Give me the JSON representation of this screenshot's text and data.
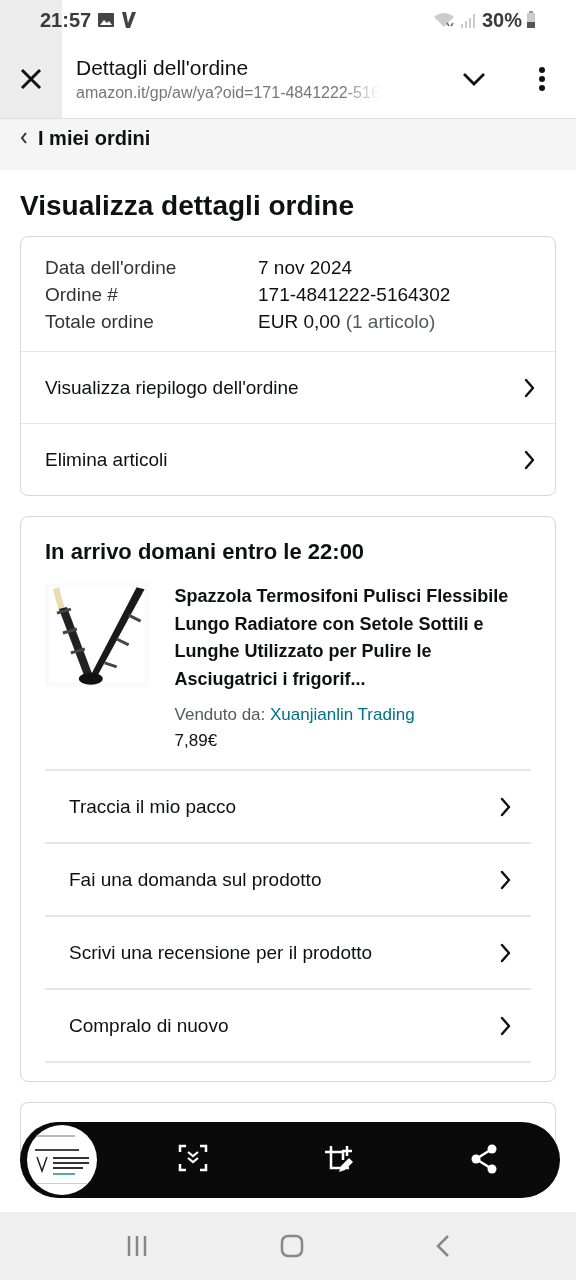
{
  "status_bar": {
    "time": "21:57",
    "battery": "30%"
  },
  "browser": {
    "title": "Dettagli dell'ordine",
    "url": "amazon.it/gp/aw/ya?oid=171-4841222-516"
  },
  "breadcrumb": "I miei ordini",
  "heading": "Visualizza dettagli ordine",
  "summary": {
    "fields": [
      {
        "label": "Data dell'ordine",
        "value": "7 nov 2024"
      },
      {
        "label": "Ordine #",
        "value": "171-4841222-5164302"
      },
      {
        "label": "Totale ordine",
        "value": "EUR 0,00",
        "note": "(1 articolo)"
      }
    ],
    "links": [
      "Visualizza riepilogo dell'ordine",
      "Elimina articoli"
    ]
  },
  "shipment": {
    "status": "In arrivo domani entro le 22:00",
    "product": {
      "title": "Spazzola Termosifoni Pulisci Flessibile Lungo Radiatore con Setole Sottili e Lunghe Utilizzato per Pulire le Asciugatrici i frigorif...",
      "seller_label": "Venduto da:",
      "seller": "Xuanjianlin Trading",
      "price": "7,89€"
    },
    "actions": [
      "Traccia il mio pacco",
      "Fai una domanda sul prodotto",
      "Scrivi una recensione per il prodotto",
      "Compralo di nuovo"
    ]
  }
}
